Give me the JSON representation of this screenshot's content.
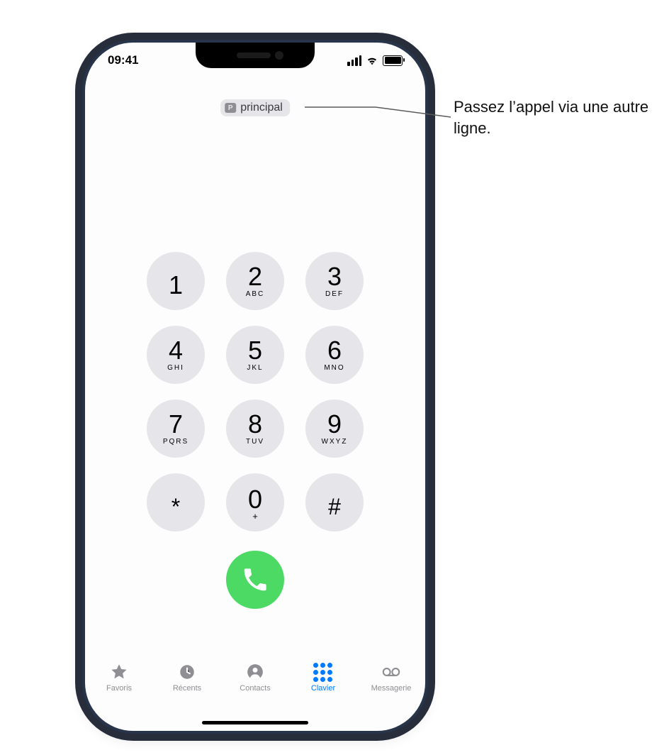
{
  "status": {
    "time": "09:41"
  },
  "line": {
    "badge": "P",
    "label": "principal"
  },
  "keys": [
    {
      "d": "1",
      "sub": ""
    },
    {
      "d": "2",
      "sub": "ABC"
    },
    {
      "d": "3",
      "sub": "DEF"
    },
    {
      "d": "4",
      "sub": "GHI"
    },
    {
      "d": "5",
      "sub": "JKL"
    },
    {
      "d": "6",
      "sub": "MNO"
    },
    {
      "d": "7",
      "sub": "PQRS"
    },
    {
      "d": "8",
      "sub": "TUV"
    },
    {
      "d": "9",
      "sub": "WXYZ"
    },
    {
      "d": "*",
      "sub": ""
    },
    {
      "d": "0",
      "sub": "+"
    },
    {
      "d": "#",
      "sub": ""
    }
  ],
  "tabs": {
    "favorites": "Favoris",
    "recents": "Récents",
    "contacts": "Contacts",
    "keypad": "Clavier",
    "voicemail": "Messagerie",
    "active": "keypad"
  },
  "callout": {
    "text": "Passez l’appel via une autre ligne."
  }
}
